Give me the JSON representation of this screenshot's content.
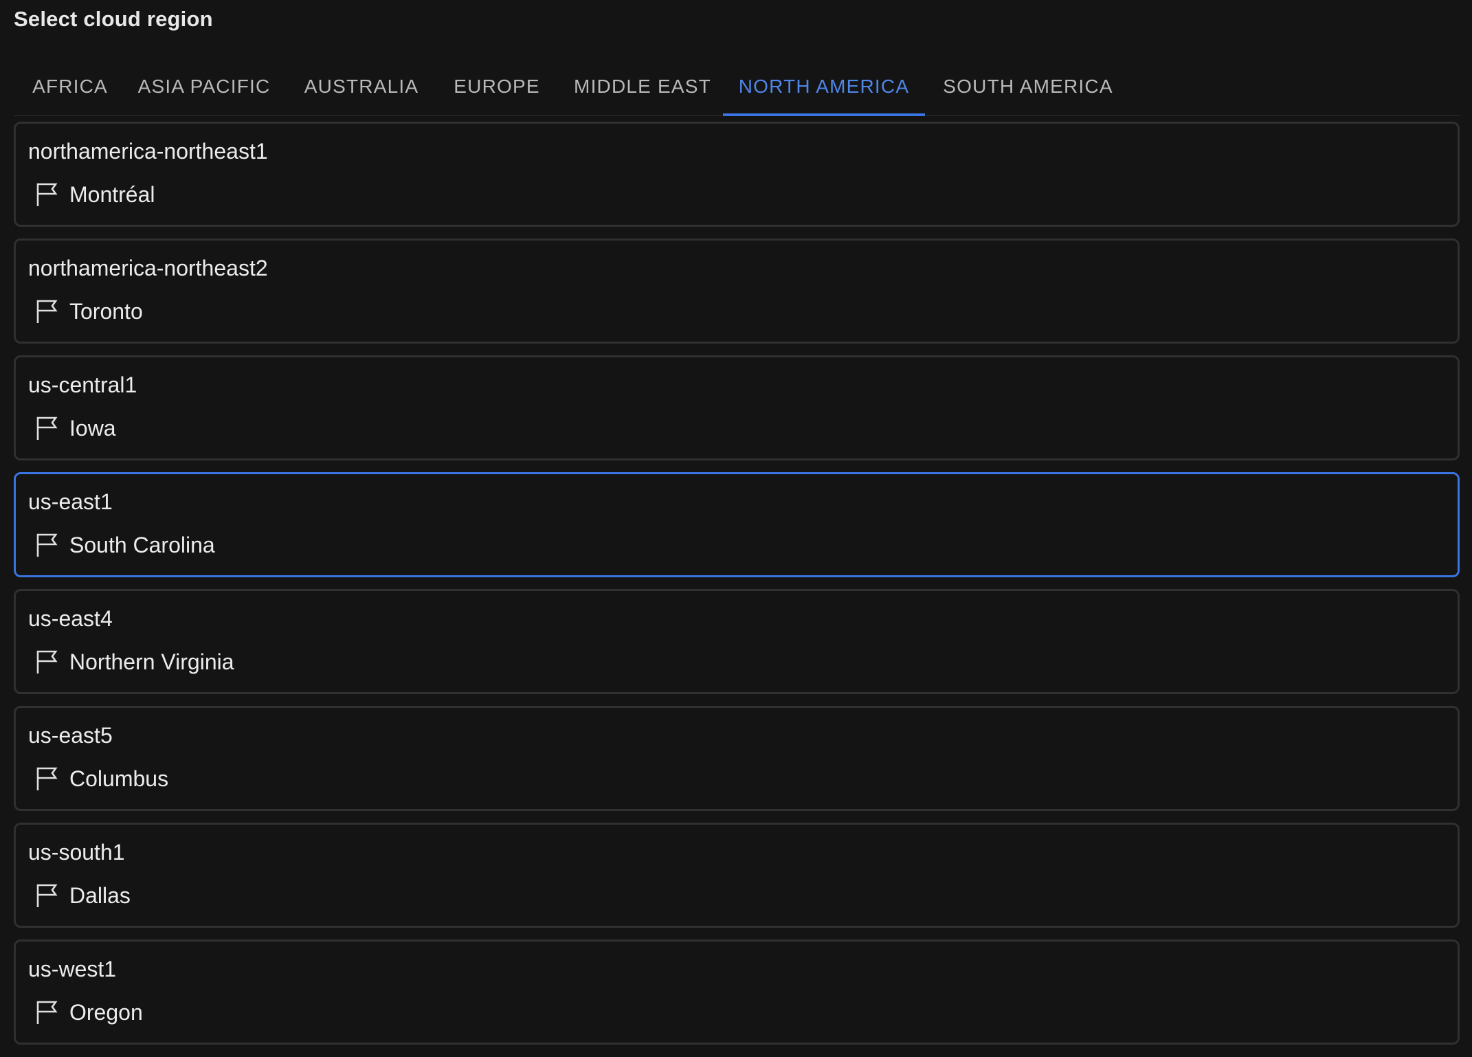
{
  "header": {
    "title": "Select cloud region"
  },
  "tabs": [
    {
      "label": "AFRICA",
      "active": false
    },
    {
      "label": "ASIA PACIFIC",
      "active": false
    },
    {
      "label": "AUSTRALIA",
      "active": false
    },
    {
      "label": "EUROPE",
      "active": false
    },
    {
      "label": "MIDDLE EAST",
      "active": false
    },
    {
      "label": "NORTH AMERICA",
      "active": true
    },
    {
      "label": "SOUTH AMERICA",
      "active": false
    }
  ],
  "regions": [
    {
      "id": "northamerica-northeast1",
      "location": "Montréal",
      "icon": "flag-icon",
      "selected": false
    },
    {
      "id": "northamerica-northeast2",
      "location": "Toronto",
      "icon": "flag-icon",
      "selected": false
    },
    {
      "id": "us-central1",
      "location": "Iowa",
      "icon": "flag-icon",
      "selected": false
    },
    {
      "id": "us-east1",
      "location": "South Carolina",
      "icon": "flag-icon",
      "selected": true
    },
    {
      "id": "us-east4",
      "location": "Northern Virginia",
      "icon": "flag-icon",
      "selected": false
    },
    {
      "id": "us-east5",
      "location": "Columbus",
      "icon": "flag-icon",
      "selected": false
    },
    {
      "id": "us-south1",
      "location": "Dallas",
      "icon": "flag-icon",
      "selected": false
    },
    {
      "id": "us-west1",
      "location": "Oregon",
      "icon": "flag-icon",
      "selected": false
    }
  ],
  "colors": {
    "background": "#141414",
    "accent": "#3a74e0",
    "card_border": "#303030",
    "text": "#ececec",
    "tab_text": "#b9b9b9"
  }
}
